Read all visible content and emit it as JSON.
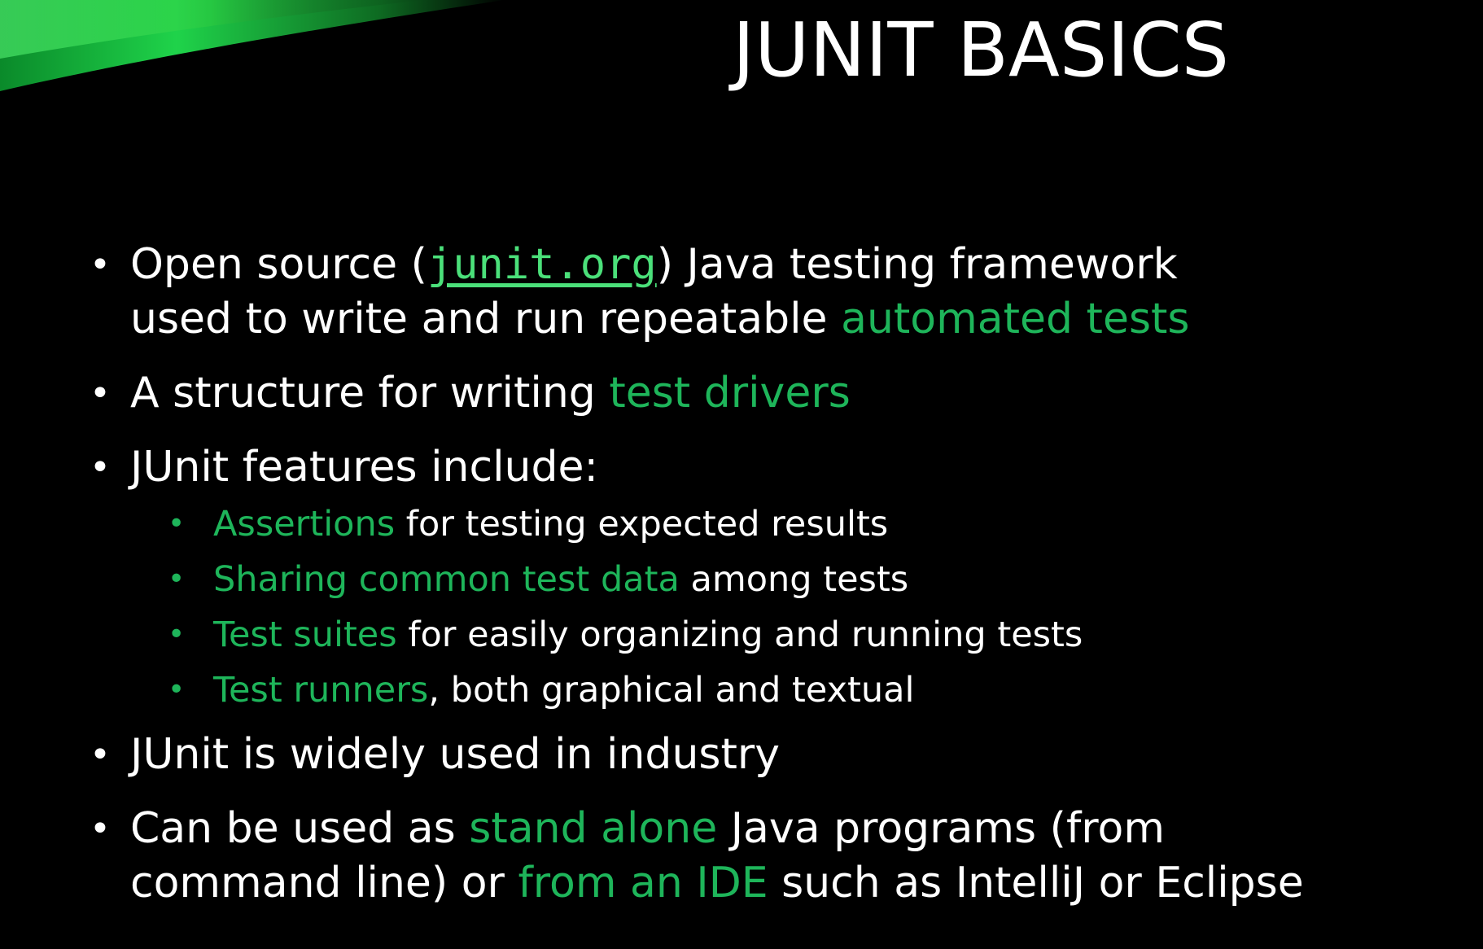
{
  "slide": {
    "title": "JUNIT BASICS",
    "colors": {
      "background": "#000000",
      "text": "#ffffff",
      "highlight": "#1eb55a",
      "link": "#4be07a",
      "accent_swoosh": "#2ecc40"
    },
    "bullets": [
      {
        "line1_pre": "Open source (",
        "link": "junit.org",
        "line1_post": ") Java testing framework",
        "line2_pre": "used to write and run repeatable ",
        "line2_highlight": "automated tests"
      },
      {
        "pre": "A structure for writing ",
        "highlight": "test drivers"
      },
      {
        "text": "JUnit features include:",
        "sub_items": [
          {
            "highlight": "Assertions",
            "rest": " for testing expected results"
          },
          {
            "highlight": "Sharing common test data",
            "rest": " among tests"
          },
          {
            "highlight": "Test suites",
            "rest": " for easily organizing and running tests"
          },
          {
            "highlight": "Test runners",
            "rest": ", both graphical and textual"
          }
        ]
      },
      {
        "text": "JUnit is widely used in industry"
      },
      {
        "line1_pre": "Can be used as ",
        "line1_highlight": "stand alone",
        "line1_post": " Java programs (from",
        "line2_pre": "command line) or ",
        "line2_highlight": "from an IDE",
        "line2_post": " such as IntelliJ or Eclipse"
      }
    ],
    "bullet_glyph": "•"
  }
}
